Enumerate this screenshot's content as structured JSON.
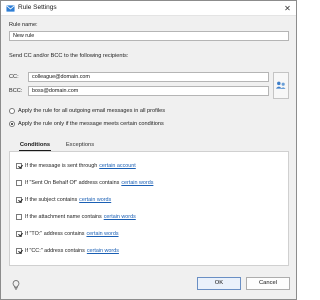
{
  "window": {
    "title": "Rule Settings",
    "close_glyph": "✕"
  },
  "form": {
    "rule_name_label": "Rule name:",
    "rule_name_value": "New rule",
    "send_label": "Send CC and/or BCC to the following recipients:",
    "cc_label": "CC:",
    "cc_value": "colleague@domain.com",
    "bcc_label": "BCC:",
    "bcc_value": "boss@domain.com",
    "address_book_icon": "contacts-icon"
  },
  "scope": {
    "options": [
      {
        "label": "Apply the rule for all outgoing email messages in all profiles",
        "selected": false
      },
      {
        "label": "Apply the rule only if the message meets certain conditions",
        "selected": true
      }
    ]
  },
  "tabs": [
    {
      "label": "Conditions",
      "active": true
    },
    {
      "label": "Exceptions",
      "active": false
    }
  ],
  "conditions": [
    {
      "text": "If the message is sent through",
      "link": "certain account",
      "checked": true
    },
    {
      "text": "If \"Sent On Behalf Of\" address contains",
      "link": "certain words",
      "checked": false
    },
    {
      "text": "If the subject contains",
      "link": "certain words",
      "checked": true
    },
    {
      "text": "If the attachment name contains",
      "link": "certain words",
      "checked": false
    },
    {
      "text": "If \"TO:\" address contains",
      "link": "certain words",
      "checked": true
    },
    {
      "text": "If \"CC:\" address contains",
      "link": "certain words",
      "checked": true
    }
  ],
  "footer": {
    "ok_label": "OK",
    "cancel_label": "Cancel",
    "hint_icon": "lightbulb-icon"
  },
  "colors": {
    "link": "#1a5fb4",
    "accent": "#1e6bd1",
    "window_bg": "#f0f0f0"
  }
}
